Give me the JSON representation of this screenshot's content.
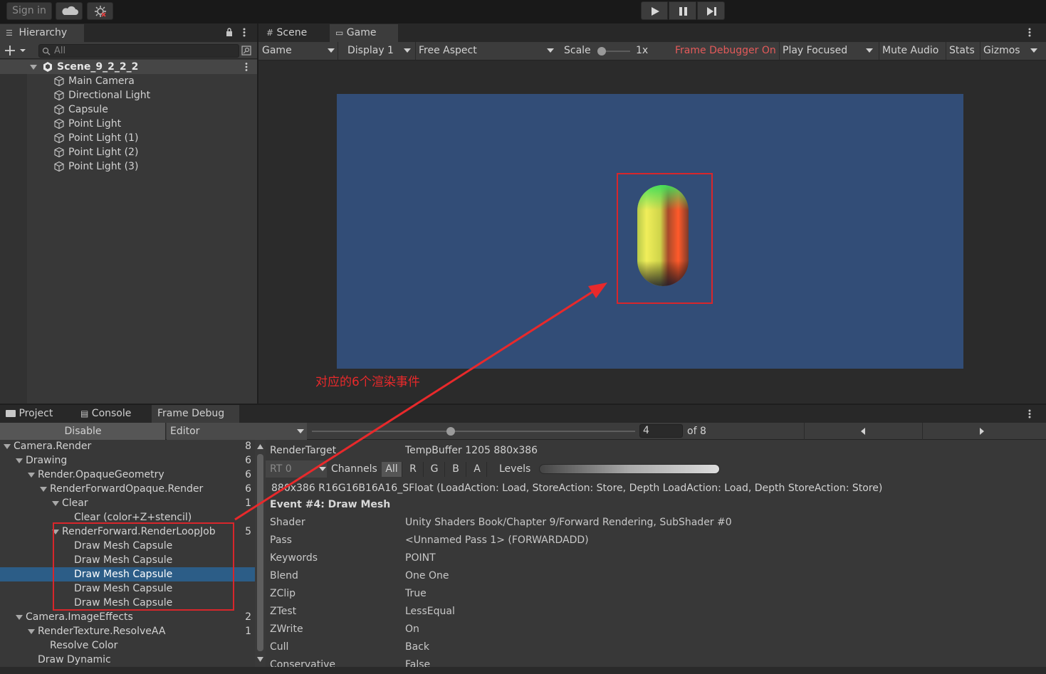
{
  "toolbar": {
    "sign_in": "Sign in",
    "cloud_icon": "cloud-icon",
    "collab_icon": "collab-icon",
    "play_icon": "play-icon",
    "pause_icon": "pause-icon",
    "step_icon": "step-icon"
  },
  "hierarchy": {
    "tab_label": "Hierarchy",
    "search_placeholder": "All",
    "scene_name": "Scene_9_2_2_2",
    "items": [
      "Main Camera",
      "Directional Light",
      "Capsule",
      "Point Light",
      "Point Light (1)",
      "Point Light (2)",
      "Point Light (3)"
    ]
  },
  "game_view": {
    "tabs": [
      "Scene",
      "Game"
    ],
    "game_dropdown": "Game",
    "display_dropdown": "Display 1",
    "aspect_dropdown": "Free Aspect",
    "scale_label": "Scale",
    "scale_value": "1x",
    "frame_debugger_on": "Frame Debugger On",
    "play_focused": "Play Focused",
    "mute_audio": "Mute Audio",
    "stats": "Stats",
    "gizmos": "Gizmos",
    "background_color": "#324d77",
    "annotation_text": "对应的6个渲染事件",
    "annotation_color": "#e8292b"
  },
  "bottom_tabs": [
    "Project",
    "Console",
    "Frame Debug"
  ],
  "frame_debug": {
    "disable_button": "Disable",
    "target_dropdown": "Editor",
    "event_index": "4",
    "event_total": "of 8",
    "tree": [
      {
        "label": "Camera.Render",
        "count": "8",
        "depth": 0,
        "expand": true
      },
      {
        "label": "Drawing",
        "count": "6",
        "depth": 1,
        "expand": true
      },
      {
        "label": "Render.OpaqueGeometry",
        "count": "6",
        "depth": 2,
        "expand": true
      },
      {
        "label": "RenderForwardOpaque.Render",
        "count": "6",
        "depth": 3,
        "expand": true
      },
      {
        "label": "Clear",
        "count": "1",
        "depth": 4,
        "expand": true
      },
      {
        "label": "Clear (color+Z+stencil)",
        "count": "",
        "depth": 5,
        "expand": false
      },
      {
        "label": "RenderForward.RenderLoopJob",
        "count": "5",
        "depth": 4,
        "expand": true
      },
      {
        "label": "Draw Mesh Capsule",
        "count": "",
        "depth": 5,
        "expand": false
      },
      {
        "label": "Draw Mesh Capsule",
        "count": "",
        "depth": 5,
        "expand": false
      },
      {
        "label": "Draw Mesh Capsule",
        "count": "",
        "depth": 5,
        "expand": false,
        "selected": true
      },
      {
        "label": "Draw Mesh Capsule",
        "count": "",
        "depth": 5,
        "expand": false
      },
      {
        "label": "Draw Mesh Capsule",
        "count": "",
        "depth": 5,
        "expand": false
      },
      {
        "label": "Camera.ImageEffects",
        "count": "2",
        "depth": 1,
        "expand": true
      },
      {
        "label": "RenderTexture.ResolveAA",
        "count": "1",
        "depth": 2,
        "expand": true
      },
      {
        "label": "Resolve Color",
        "count": "",
        "depth": 3,
        "expand": false
      },
      {
        "label": "Draw Dynamic",
        "count": "",
        "depth": 2,
        "expand": false
      }
    ],
    "render_target_label": "RenderTarget",
    "render_target_value": "TempBuffer 1205 880x386",
    "rt_dropdown": "RT 0",
    "channels_label": "Channels",
    "channels": [
      "All",
      "R",
      "G",
      "B",
      "A"
    ],
    "levels_label": "Levels",
    "format_line": "880x386 R16G16B16A16_SFloat (LoadAction: Load, StoreAction: Store, Depth LoadAction: Load, Depth StoreAction: Store)",
    "event_title": "Event #4: Draw Mesh",
    "properties": [
      {
        "label": "Shader",
        "value": "Unity Shaders Book/Chapter 9/Forward Rendering, SubShader #0"
      },
      {
        "label": "Pass",
        "value": "<Unnamed Pass 1> (FORWARDADD)"
      },
      {
        "label": "Keywords",
        "value": "POINT"
      },
      {
        "label": "Blend",
        "value": "One One"
      },
      {
        "label": "ZClip",
        "value": "True"
      },
      {
        "label": "ZTest",
        "value": "LessEqual"
      },
      {
        "label": "ZWrite",
        "value": "On"
      },
      {
        "label": "Cull",
        "value": "Back"
      },
      {
        "label": "Conservative",
        "value": "False"
      }
    ]
  }
}
